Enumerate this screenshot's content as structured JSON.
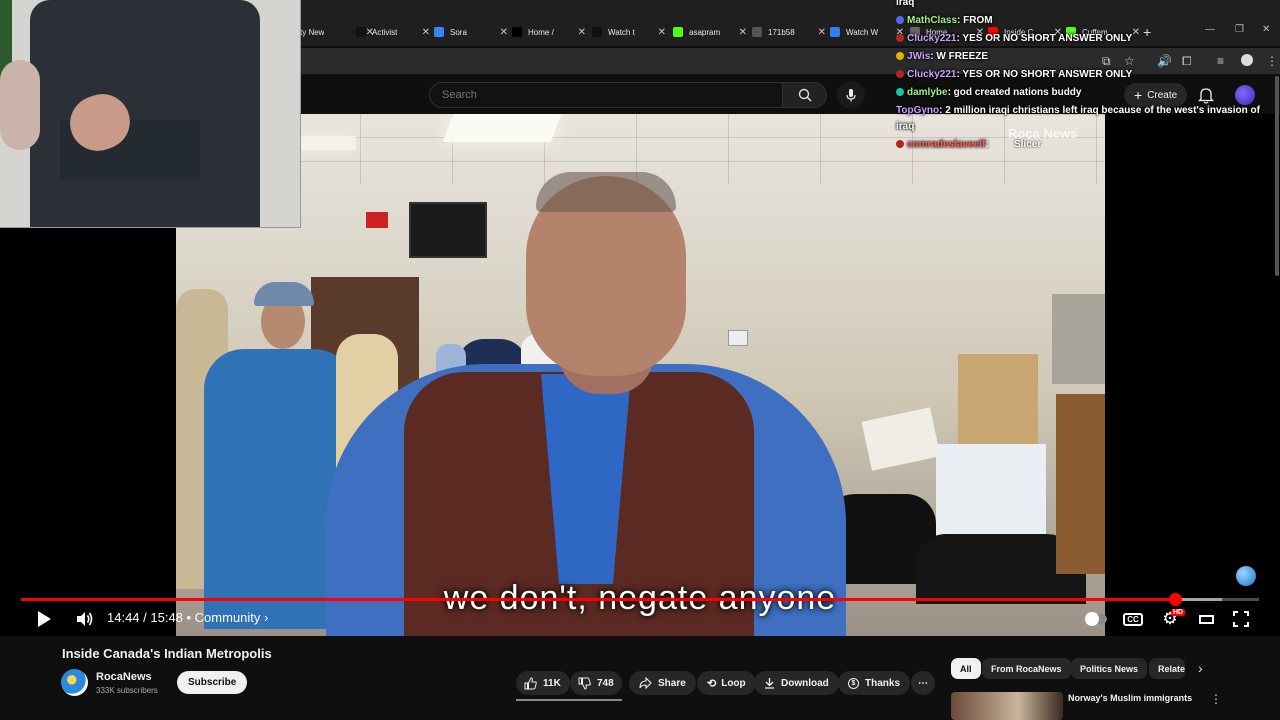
{
  "browser": {
    "tabs": [
      {
        "label": "ty New",
        "icon": "news-icon",
        "color": "#444444"
      },
      {
        "label": "Activist",
        "icon": "tiktok-icon",
        "color": "#111111"
      },
      {
        "label": "Sora",
        "icon": "sora-icon",
        "color": "#3b82f6"
      },
      {
        "label": "Home /",
        "icon": "x-icon",
        "color": "#000000"
      },
      {
        "label": "Watch t",
        "icon": "tiktok-icon",
        "color": "#111111"
      },
      {
        "label": "asapram",
        "icon": "kick-icon",
        "color": "#53fc18"
      },
      {
        "label": "171b58",
        "icon": "web-icon",
        "color": "#555555"
      },
      {
        "label": "Watch W",
        "icon": "web-icon",
        "color": "#2f80ed"
      },
      {
        "label": "Home",
        "icon": "web-icon",
        "color": "#666666"
      },
      {
        "label": "Inside C",
        "icon": "youtube-icon",
        "color": "#ff0000"
      },
      {
        "label": "Cuffem",
        "icon": "kick-icon",
        "color": "#53fc18"
      }
    ],
    "new_tab": "+"
  },
  "header": {
    "search_placeholder": "Search",
    "create_label": "Create"
  },
  "chat": {
    "messages": [
      {
        "user": "",
        "text": "iraq",
        "user_color": "#ffffff",
        "badge_color": ""
      },
      {
        "user": "MathClass",
        "text": ": FROM",
        "user_color": "#a0f07a",
        "badge_color": "#5865f2"
      },
      {
        "user": "Clucky221",
        "text": ": YES OR NO SHORT ANSWER ONLY",
        "user_color": "#c9a0ff",
        "badge_color": "#b3261e"
      },
      {
        "user": "JWis",
        "text": ": W FREEZE",
        "user_color": "#c9a0ff",
        "badge_color": "#e8b200"
      },
      {
        "user": "Clucky221",
        "text": ": YES OR NO SHORT ANSWER ONLY",
        "user_color": "#c9a0ff",
        "badge_color": "#b3261e"
      },
      {
        "user": "damlybe",
        "text": ": god created nations buddy",
        "user_color": "#a0f07a",
        "badge_color": "#1bc4a1"
      },
      {
        "user": "TopGyno",
        "text": ": 2 million iraqi christians left iraq because of the west's invasion of",
        "user_color": "#c9a0ff",
        "badge_color": ""
      },
      {
        "user": "",
        "text": "iraq",
        "user_color": "#ffffff",
        "badge_color": ""
      },
      {
        "user": "comradeslaveelf",
        "text": ":",
        "user_color": "#ff5a5a",
        "badge_color": "#b3261e"
      }
    ],
    "slicer_label": "Slicer"
  },
  "video": {
    "subtitle": "we don't, negate anyone",
    "watermark": "Roca News",
    "progress_fraction": 0.932,
    "buffer_fraction": 0.97,
    "time_current": "14:44",
    "time_total": "15:48",
    "chapter": "Community",
    "time_display": "14:44 / 15:48 • Community ›",
    "hd_badge": "HD"
  },
  "below": {
    "title": "Inside Canada's Indian Metropolis",
    "channel_name": "RocaNews",
    "subscribers": "333K subscribers",
    "subscribe_label": "Subscribe",
    "likes": "11K",
    "dislikes": "748",
    "share_label": "Share",
    "loop_label": "Loop",
    "download_label": "Download",
    "thanks_label": "Thanks",
    "more_label": "⋯"
  },
  "sidebar": {
    "chips": [
      "All",
      "From RocaNews",
      "Politics News",
      "Relate"
    ],
    "recommendation_title": "Norway's Muslim immigrants"
  }
}
